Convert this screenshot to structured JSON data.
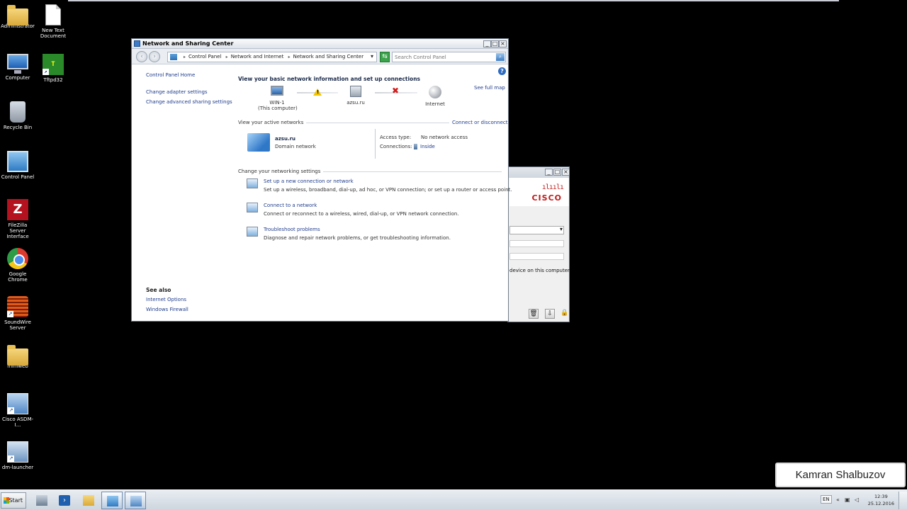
{
  "desktop": {
    "icons": [
      {
        "id": "administrator",
        "label": "Administrator",
        "icon": "folder-icon"
      },
      {
        "id": "new-text-document",
        "label": "New Text Document",
        "icon": "text-document-icon"
      },
      {
        "id": "computer",
        "label": "Computer",
        "icon": "computer-icon"
      },
      {
        "id": "tftpd32",
        "label": "Tftpd32",
        "icon": "tftpd32-icon"
      },
      {
        "id": "recycle-bin",
        "label": "Recycle Bin",
        "icon": "recycle-bin-icon"
      },
      {
        "id": "control-panel",
        "label": "Control Panel",
        "icon": "control-panel-icon"
      },
      {
        "id": "filezilla",
        "label": "FileZilla Server Interface",
        "icon": "filezilla-icon"
      },
      {
        "id": "chrome",
        "label": "Google Chrome",
        "icon": "chrome-icon"
      },
      {
        "id": "soundwire",
        "label": "SoundWire Server",
        "icon": "soundwire-icon"
      },
      {
        "id": "miniweb",
        "label": "miniweb",
        "icon": "folder-icon"
      },
      {
        "id": "asdm",
        "label": "Cisco ASDM-I...",
        "icon": "cisco-asdm-icon"
      },
      {
        "id": "dm-launcher",
        "label": "dm-launcher",
        "icon": "dm-launcher-icon"
      }
    ]
  },
  "window": {
    "title": "Network and Sharing Center",
    "breadcrumbs": [
      "Control Panel",
      "Network and Internet",
      "Network and Sharing Center"
    ],
    "search_placeholder": "Search Control Panel",
    "left": {
      "home": "Control Panel Home",
      "links": [
        "Change adapter settings",
        "Change advanced sharing settings"
      ],
      "see_also_title": "See also",
      "see_also": [
        "Internet Options",
        "Windows Firewall"
      ]
    },
    "main": {
      "heading": "View your basic network information and set up connections",
      "see_full_map": "See full map",
      "map": {
        "computer_name": "WIN-1",
        "computer_sub": "(This computer)",
        "domain": "azsu.ru",
        "internet": "Internet"
      },
      "active_title": "View your active networks",
      "connect_link": "Connect or disconnect",
      "active_network": {
        "name": "azsu.ru",
        "type": "Domain network",
        "access_label": "Access type:",
        "access_value": "No network access",
        "connections_label": "Connections:",
        "connections_value": "Inside"
      },
      "change_title": "Change your networking settings",
      "tasks": [
        {
          "title": "Set up a new connection or network",
          "desc": "Set up a wireless, broadband, dial-up, ad hoc, or VPN connection; or set up a router or access point."
        },
        {
          "title": "Connect to a network",
          "desc": "Connect or reconnect to a wireless, wired, dial-up, or VPN network connection."
        },
        {
          "title": "Troubleshoot problems",
          "desc": "Diagnose and repair network problems, or get troubleshooting information."
        }
      ]
    }
  },
  "cisco_window": {
    "brand": "CISCO",
    "partial_text": "device on this computer"
  },
  "watermark": "Kamran Shalbuzov",
  "taskbar": {
    "start": "Start",
    "lang": "EN",
    "time": "12:39",
    "date": "25.12.2016"
  },
  "colors": {
    "link": "#1f3d8c",
    "cisco_red": "#c01a1a",
    "warning": "#f0c400",
    "error": "#d21919"
  }
}
